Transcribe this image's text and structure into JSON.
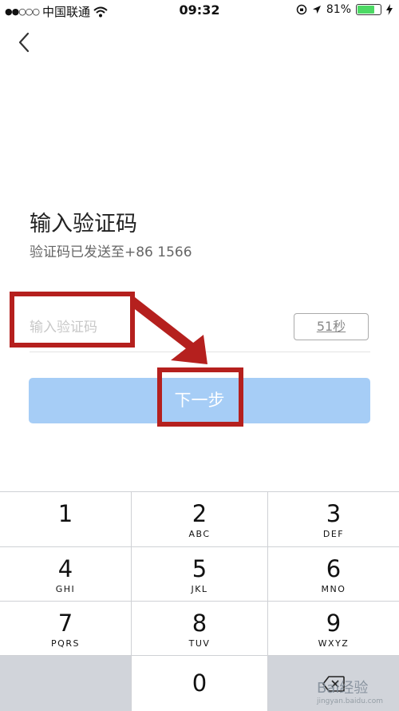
{
  "status_bar": {
    "signal": "●●○○○",
    "carrier": "中国联通",
    "time": "09:32",
    "battery_percent": "81%",
    "battery_level": 0.81
  },
  "header": {
    "back_icon": "chevron-left-icon"
  },
  "verification": {
    "title": "输入验证码",
    "subtitle": "验证码已发送至+86 1566",
    "input_placeholder": "输入验证码",
    "countdown": "51秒",
    "next_button": "下一步"
  },
  "keypad": {
    "keys": [
      {
        "num": "1",
        "letters": ""
      },
      {
        "num": "2",
        "letters": "ABC"
      },
      {
        "num": "3",
        "letters": "DEF"
      },
      {
        "num": "4",
        "letters": "GHI"
      },
      {
        "num": "5",
        "letters": "JKL"
      },
      {
        "num": "6",
        "letters": "MNO"
      },
      {
        "num": "7",
        "letters": "PQRS"
      },
      {
        "num": "8",
        "letters": "TUV"
      },
      {
        "num": "9",
        "letters": "WXYZ"
      },
      {
        "num": "0",
        "letters": ""
      }
    ],
    "delete_icon": "backspace-icon"
  },
  "watermark": {
    "text": "Bai经验",
    "url": "jingyan.baidu.com"
  },
  "colors": {
    "button_bg": "#a6cdf6",
    "annotation": "#b5201e",
    "keypad_gray": "#d1d4da",
    "battery_fill": "#4cd964"
  }
}
